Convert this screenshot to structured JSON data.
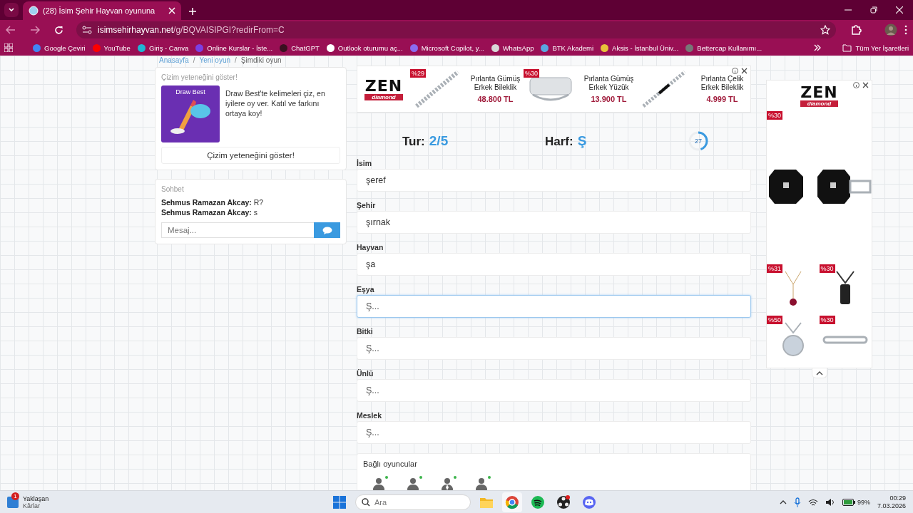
{
  "browser": {
    "tab": {
      "title": "(28) İsim Şehir Hayvan oyununa"
    },
    "address": {
      "domain": "isimsehirhayvan.net",
      "path": "/g/BQVAISIPGI?redirFrom=C"
    },
    "bookmarks": [
      {
        "label": "Google Çeviri",
        "color": "#4285f4"
      },
      {
        "label": "YouTube",
        "color": "#ff0000"
      },
      {
        "label": "Giriş - Canva",
        "color": "#1fb6d4"
      },
      {
        "label": "Online Kurslar - İste...",
        "color": "#7b3fe4"
      },
      {
        "label": "ChatGPT",
        "color": "#3a1020"
      },
      {
        "label": "Outlook oturumu aç...",
        "color": "#ffffff"
      },
      {
        "label": "Microsoft Copilot, y...",
        "color": "#8a6cf0"
      },
      {
        "label": "WhatsApp",
        "color": "#d8d8d8"
      },
      {
        "label": "BTK Akademi",
        "color": "#5aa7e0"
      },
      {
        "label": "Aksis - İstanbul Üniv...",
        "color": "#e8c23a"
      },
      {
        "label": "Bettercap Kullanımı...",
        "color": "#777777"
      }
    ],
    "all_bookmarks": "Tüm Yer İşaretleri"
  },
  "breadcrumb": {
    "items": [
      "Anasayfa",
      "Yeni oyun",
      "Şimdiki oyun"
    ],
    "separator": "/"
  },
  "promo": {
    "title": "Çizim yeteneğini göster!",
    "image_title": "Draw Best",
    "text": "Draw Best'te kelimeleri çiz, en iyilere oy ver. Katıl ve farkını ortaya koy!",
    "button": "Çizim yeteneğini göster!"
  },
  "chat": {
    "title": "Sohbet",
    "messages": [
      {
        "author": "Sehmus Ramazan Akcay:",
        "text": "R?"
      },
      {
        "author": "Sehmus Ramazan Akcay:",
        "text": "s"
      }
    ],
    "placeholder": "Mesaj..."
  },
  "top_ad": {
    "brand": "ZEN",
    "brand_sub": "diamond",
    "products": [
      {
        "kind": "chain",
        "discount": "%29",
        "name": "Pırlanta Gümüş Erkek Bileklik",
        "price": "48.800 TL"
      },
      {
        "kind": "ring",
        "discount": "%30",
        "name": "Pırlanta Gümüş Erkek Yüzük",
        "price": "13.900 TL"
      },
      {
        "kind": "bar",
        "name": "Pırlanta Çelik Erkek Bileklik",
        "price": "4.999 TL"
      }
    ]
  },
  "game": {
    "round_label": "Tur:",
    "round": "2/5",
    "letter_label": "Harf:",
    "letter": "Ş",
    "timer": {
      "value": "27",
      "level": 0.45
    },
    "fields": [
      {
        "label": "İsim",
        "value": "şeref",
        "focused": false
      },
      {
        "label": "Şehir",
        "value": "şırnak",
        "focused": false
      },
      {
        "label": "Hayvan",
        "value": "şa",
        "focused": false
      },
      {
        "label": "Eşya",
        "placeholder": "Ş...",
        "focused": true
      },
      {
        "label": "Bitki",
        "placeholder": "Ş...",
        "focused": false
      },
      {
        "label": "Ünlü",
        "placeholder": "Ş...",
        "focused": false
      },
      {
        "label": "Meslek",
        "placeholder": "Ş...",
        "focused": false
      }
    ],
    "players_title": "Bağlı oyuncular",
    "players": [
      {
        "kind": "user",
        "online": true
      },
      {
        "kind": "user",
        "online": true
      },
      {
        "kind": "user-tie",
        "online": true
      },
      {
        "kind": "user",
        "online": true
      }
    ]
  },
  "side_ad": {
    "brand": "ZEN",
    "brand_sub": "diamond",
    "items": [
      {
        "kind": "cufflinks",
        "discount": "%30"
      },
      {
        "kind": "pendant",
        "discount": "%31"
      },
      {
        "kind": "tag",
        "discount": "%30"
      },
      {
        "kind": "locket",
        "discount": "%50"
      },
      {
        "kind": "bracelet",
        "discount": "%30"
      }
    ]
  },
  "taskbar": {
    "widget": {
      "title": "Yaklaşan",
      "subtitle": "Kârlar",
      "badge": "1"
    },
    "search": {
      "placeholder": "Ara"
    },
    "apps": [
      {
        "kind": "folder",
        "selected": false
      },
      {
        "kind": "chrome",
        "selected": true
      },
      {
        "kind": "spotify",
        "selected": false
      },
      {
        "kind": "obs",
        "selected": false
      },
      {
        "kind": "discord",
        "selected": false
      }
    ],
    "battery": "99%",
    "time": "00:29",
    "date": "7.03.2026"
  }
}
